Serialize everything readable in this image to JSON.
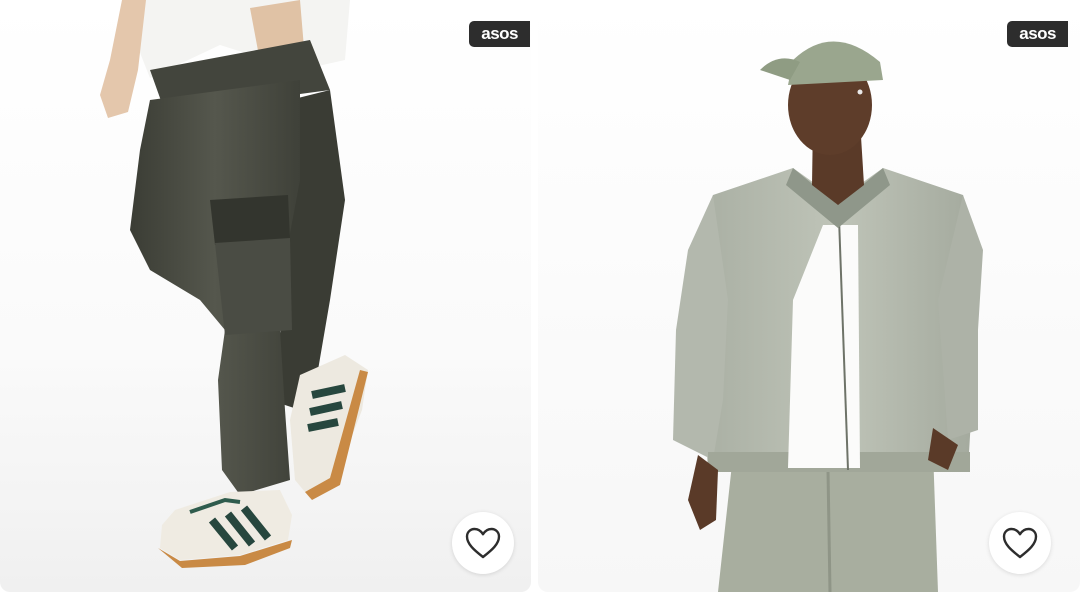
{
  "products": [
    {
      "brand_tag": "asos",
      "photo_icon": "product-photo-cargo-trousers",
      "save_icon": "heart-icon"
    },
    {
      "brand_tag": "asos",
      "photo_icon": "product-photo-bomber-jacket",
      "save_icon": "heart-icon"
    }
  ],
  "colors": {
    "tag_background": "#2d2d2d",
    "tag_text": "#ffffff",
    "heart_stroke": "#2d2d2d"
  }
}
